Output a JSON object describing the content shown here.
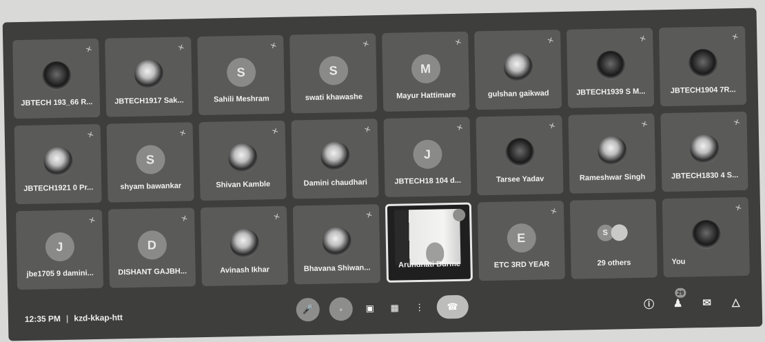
{
  "participants": [
    {
      "name": "JBTECH 193_66 R...",
      "initial": "",
      "style": "dark"
    },
    {
      "name": "JBTECH1917 Sak...",
      "initial": "",
      "style": "photo"
    },
    {
      "name": "Sahili Meshram",
      "initial": "S",
      "style": "letter"
    },
    {
      "name": "swati khawashe",
      "initial": "S",
      "style": "letter"
    },
    {
      "name": "Mayur Hattimare",
      "initial": "M",
      "style": "letter"
    },
    {
      "name": "gulshan gaikwad",
      "initial": "",
      "style": "photo"
    },
    {
      "name": "JBTECH1939 S M...",
      "initial": "",
      "style": "dark"
    },
    {
      "name": "JBTECH1904 7R...",
      "initial": "",
      "style": "dark"
    },
    {
      "name": "JBTECH1921 0 Pr...",
      "initial": "",
      "style": "photo"
    },
    {
      "name": "shyam bawankar",
      "initial": "S",
      "style": "letter"
    },
    {
      "name": "Shivan Kamble",
      "initial": "",
      "style": "photo"
    },
    {
      "name": "Damini chaudhari",
      "initial": "",
      "style": "photo"
    },
    {
      "name": "JBTECH18 104 d...",
      "initial": "J",
      "style": "letter"
    },
    {
      "name": "Tarsee Yadav",
      "initial": "",
      "style": "dark"
    },
    {
      "name": "Rameshwar Singh",
      "initial": "",
      "style": "photo"
    },
    {
      "name": "JBTECH1830 4 S...",
      "initial": "",
      "style": "photo"
    },
    {
      "name": "jbe1705 9 damini...",
      "initial": "J",
      "style": "letter"
    },
    {
      "name": "DISHANT GAJBH...",
      "initial": "D",
      "style": "letter"
    },
    {
      "name": "Avinash Ikhar",
      "initial": "",
      "style": "photo"
    },
    {
      "name": "Bhavana Shiwan...",
      "initial": "",
      "style": "photo"
    }
  ],
  "active_speaker": {
    "name": "Arundhati Burme"
  },
  "extra_tiles": [
    {
      "name": "ETC 3RD YEAR",
      "initial": "E",
      "style": "letter"
    }
  ],
  "others_tile": {
    "label": "29 others",
    "initial": "S"
  },
  "self_tile": {
    "name": "You"
  },
  "meeting": {
    "time": "12:35 PM",
    "separator": "|",
    "code": "kzd-kkap-htt"
  },
  "controls": {
    "icons": [
      "mic-off-icon",
      "camera-off-icon",
      "captions-icon",
      "present-icon",
      "more-icon",
      "end-call-icon"
    ]
  },
  "right_controls": {
    "icons": [
      "info-icon",
      "people-icon",
      "chat-icon",
      "activities-icon"
    ],
    "people_badge": "29"
  }
}
